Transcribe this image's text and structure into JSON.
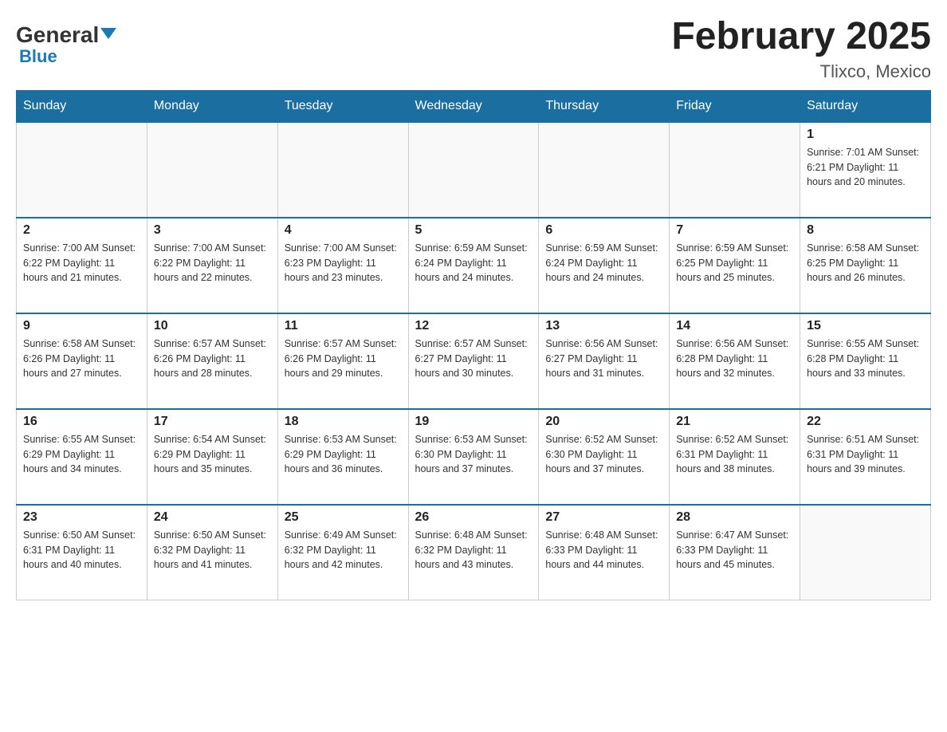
{
  "header": {
    "logo_general": "General",
    "logo_blue": "Blue",
    "month_title": "February 2025",
    "location": "Tlixco, Mexico"
  },
  "days_of_week": [
    "Sunday",
    "Monday",
    "Tuesday",
    "Wednesday",
    "Thursday",
    "Friday",
    "Saturday"
  ],
  "weeks": [
    [
      {
        "day": "",
        "info": ""
      },
      {
        "day": "",
        "info": ""
      },
      {
        "day": "",
        "info": ""
      },
      {
        "day": "",
        "info": ""
      },
      {
        "day": "",
        "info": ""
      },
      {
        "day": "",
        "info": ""
      },
      {
        "day": "1",
        "info": "Sunrise: 7:01 AM\nSunset: 6:21 PM\nDaylight: 11 hours\nand 20 minutes."
      }
    ],
    [
      {
        "day": "2",
        "info": "Sunrise: 7:00 AM\nSunset: 6:22 PM\nDaylight: 11 hours\nand 21 minutes."
      },
      {
        "day": "3",
        "info": "Sunrise: 7:00 AM\nSunset: 6:22 PM\nDaylight: 11 hours\nand 22 minutes."
      },
      {
        "day": "4",
        "info": "Sunrise: 7:00 AM\nSunset: 6:23 PM\nDaylight: 11 hours\nand 23 minutes."
      },
      {
        "day": "5",
        "info": "Sunrise: 6:59 AM\nSunset: 6:24 PM\nDaylight: 11 hours\nand 24 minutes."
      },
      {
        "day": "6",
        "info": "Sunrise: 6:59 AM\nSunset: 6:24 PM\nDaylight: 11 hours\nand 24 minutes."
      },
      {
        "day": "7",
        "info": "Sunrise: 6:59 AM\nSunset: 6:25 PM\nDaylight: 11 hours\nand 25 minutes."
      },
      {
        "day": "8",
        "info": "Sunrise: 6:58 AM\nSunset: 6:25 PM\nDaylight: 11 hours\nand 26 minutes."
      }
    ],
    [
      {
        "day": "9",
        "info": "Sunrise: 6:58 AM\nSunset: 6:26 PM\nDaylight: 11 hours\nand 27 minutes."
      },
      {
        "day": "10",
        "info": "Sunrise: 6:57 AM\nSunset: 6:26 PM\nDaylight: 11 hours\nand 28 minutes."
      },
      {
        "day": "11",
        "info": "Sunrise: 6:57 AM\nSunset: 6:26 PM\nDaylight: 11 hours\nand 29 minutes."
      },
      {
        "day": "12",
        "info": "Sunrise: 6:57 AM\nSunset: 6:27 PM\nDaylight: 11 hours\nand 30 minutes."
      },
      {
        "day": "13",
        "info": "Sunrise: 6:56 AM\nSunset: 6:27 PM\nDaylight: 11 hours\nand 31 minutes."
      },
      {
        "day": "14",
        "info": "Sunrise: 6:56 AM\nSunset: 6:28 PM\nDaylight: 11 hours\nand 32 minutes."
      },
      {
        "day": "15",
        "info": "Sunrise: 6:55 AM\nSunset: 6:28 PM\nDaylight: 11 hours\nand 33 minutes."
      }
    ],
    [
      {
        "day": "16",
        "info": "Sunrise: 6:55 AM\nSunset: 6:29 PM\nDaylight: 11 hours\nand 34 minutes."
      },
      {
        "day": "17",
        "info": "Sunrise: 6:54 AM\nSunset: 6:29 PM\nDaylight: 11 hours\nand 35 minutes."
      },
      {
        "day": "18",
        "info": "Sunrise: 6:53 AM\nSunset: 6:29 PM\nDaylight: 11 hours\nand 36 minutes."
      },
      {
        "day": "19",
        "info": "Sunrise: 6:53 AM\nSunset: 6:30 PM\nDaylight: 11 hours\nand 37 minutes."
      },
      {
        "day": "20",
        "info": "Sunrise: 6:52 AM\nSunset: 6:30 PM\nDaylight: 11 hours\nand 37 minutes."
      },
      {
        "day": "21",
        "info": "Sunrise: 6:52 AM\nSunset: 6:31 PM\nDaylight: 11 hours\nand 38 minutes."
      },
      {
        "day": "22",
        "info": "Sunrise: 6:51 AM\nSunset: 6:31 PM\nDaylight: 11 hours\nand 39 minutes."
      }
    ],
    [
      {
        "day": "23",
        "info": "Sunrise: 6:50 AM\nSunset: 6:31 PM\nDaylight: 11 hours\nand 40 minutes."
      },
      {
        "day": "24",
        "info": "Sunrise: 6:50 AM\nSunset: 6:32 PM\nDaylight: 11 hours\nand 41 minutes."
      },
      {
        "day": "25",
        "info": "Sunrise: 6:49 AM\nSunset: 6:32 PM\nDaylight: 11 hours\nand 42 minutes."
      },
      {
        "day": "26",
        "info": "Sunrise: 6:48 AM\nSunset: 6:32 PM\nDaylight: 11 hours\nand 43 minutes."
      },
      {
        "day": "27",
        "info": "Sunrise: 6:48 AM\nSunset: 6:33 PM\nDaylight: 11 hours\nand 44 minutes."
      },
      {
        "day": "28",
        "info": "Sunrise: 6:47 AM\nSunset: 6:33 PM\nDaylight: 11 hours\nand 45 minutes."
      },
      {
        "day": "",
        "info": ""
      }
    ]
  ]
}
